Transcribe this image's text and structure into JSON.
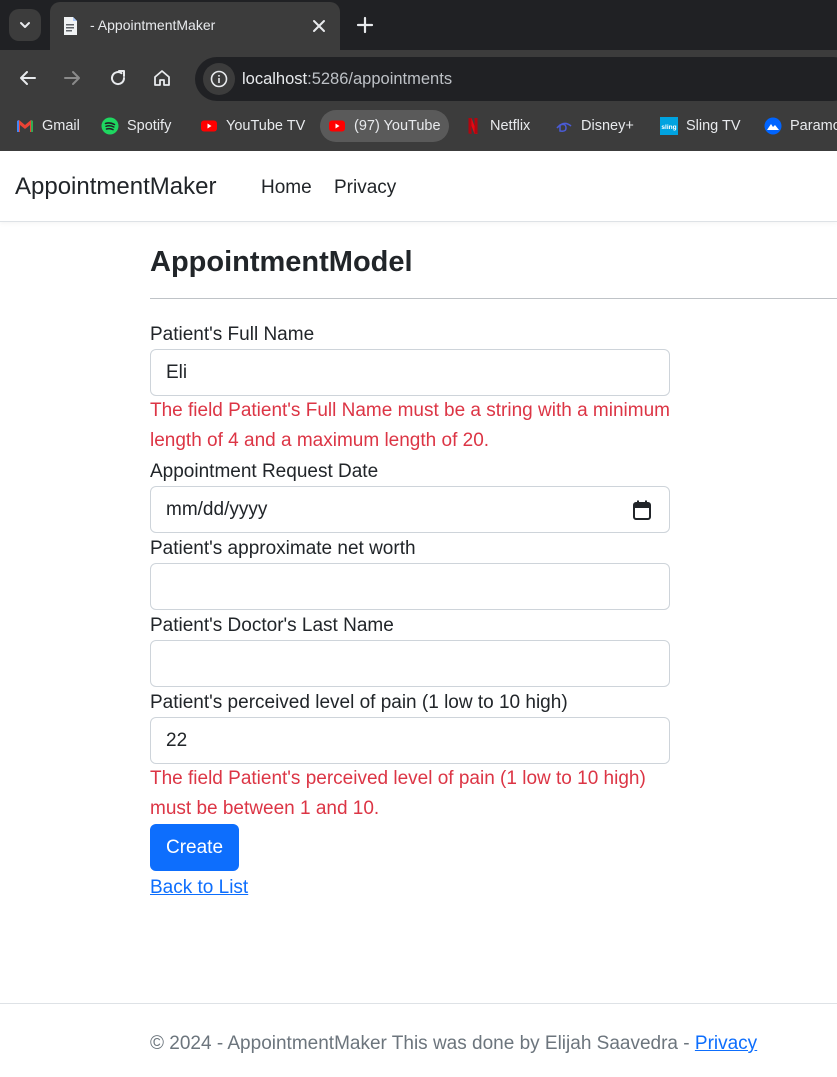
{
  "browser": {
    "tab_title": "- AppointmentMaker",
    "url_host": "localhost",
    "url_rest": ":5286/appointments",
    "bookmarks": [
      {
        "label": "Gmail",
        "icon": "gmail-icon"
      },
      {
        "label": "Spotify",
        "icon": "spotify-icon"
      },
      {
        "label": "YouTube TV",
        "icon": "youtube-tv-icon"
      },
      {
        "label": "(97) YouTube",
        "icon": "youtube-icon"
      },
      {
        "label": "Netflix",
        "icon": "netflix-icon"
      },
      {
        "label": "Disney+",
        "icon": "disney-icon"
      },
      {
        "label": "Sling TV",
        "icon": "sling-icon"
      },
      {
        "label": "Paramo",
        "icon": "paramount-icon"
      }
    ]
  },
  "nav": {
    "brand": "AppointmentMaker",
    "links": [
      "Home",
      "Privacy"
    ]
  },
  "form": {
    "heading": "AppointmentModel",
    "fields": {
      "full_name": {
        "label": "Patient's Full Name",
        "value": "Eli",
        "error": "The field Patient's Full Name must be a string with a minimum length of 4 and a maximum length of 20."
      },
      "request_date": {
        "label": "Appointment Request Date",
        "placeholder": "mm/dd/yyyy"
      },
      "net_worth": {
        "label": "Patient's approximate net worth",
        "value": ""
      },
      "doctor_last_name": {
        "label": "Patient's Doctor's Last Name",
        "value": ""
      },
      "pain_level": {
        "label": "Patient's perceived level of pain (1 low to 10 high)",
        "value": "22",
        "error": "The field Patient's perceived level of pain (1 low to 10 high) must be between 1 and 10."
      }
    },
    "submit_label": "Create",
    "back_link": "Back to List"
  },
  "footer": {
    "text": "© 2024 - AppointmentMaker This was done by Elijah Saavedra - ",
    "privacy_link": "Privacy"
  },
  "colors": {
    "error": "#dc3545",
    "primary": "#0d6efd",
    "chrome_dark": "#202124",
    "chrome_mid": "#3c3c3c"
  }
}
